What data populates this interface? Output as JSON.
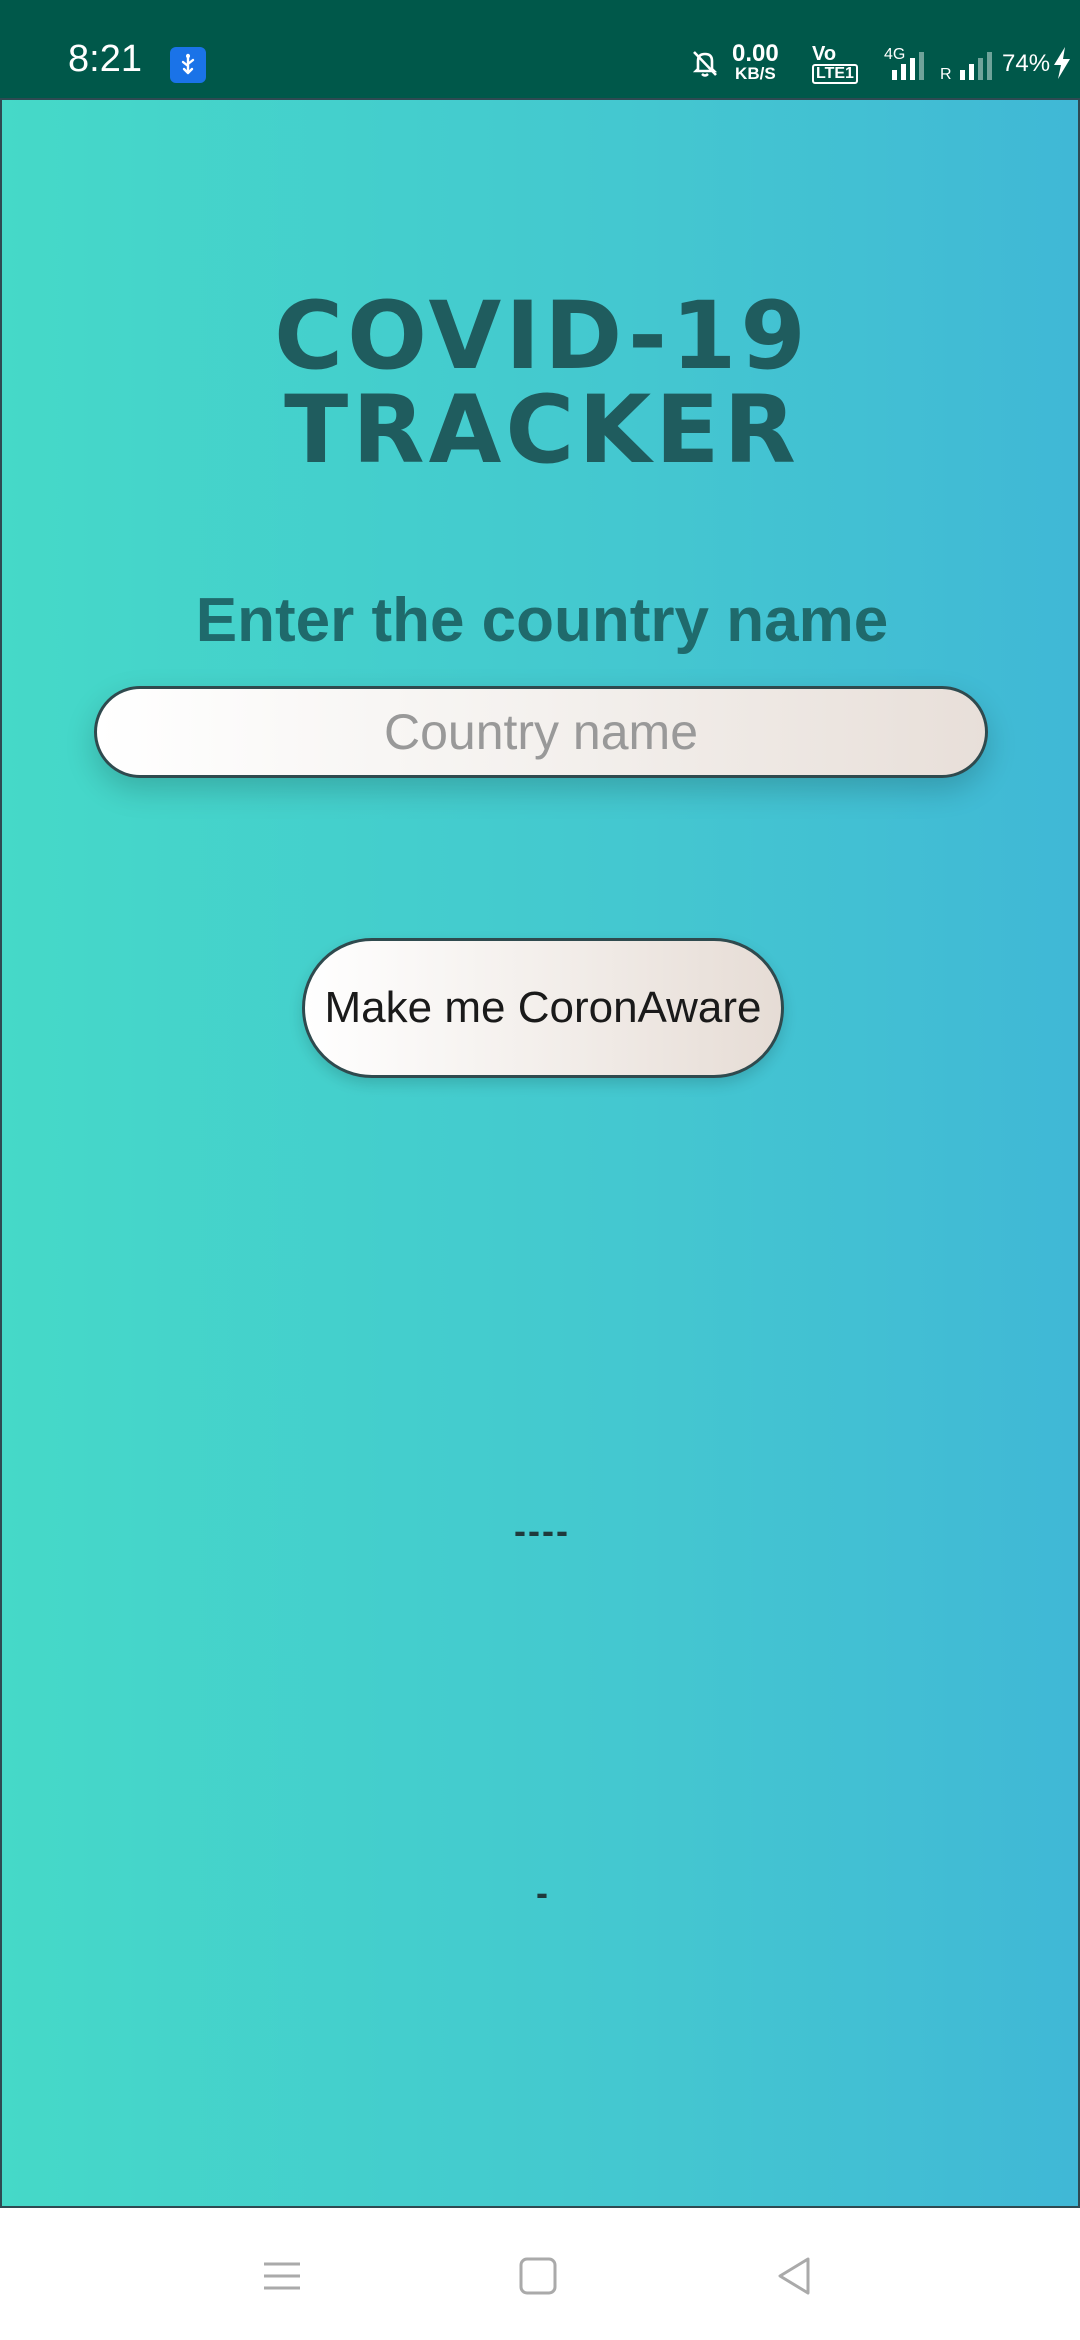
{
  "status_bar": {
    "time": "8:21",
    "net_speed_value": "0.00",
    "net_speed_unit": "KB/S",
    "volte_top": "Vo",
    "volte_bottom": "LTE1",
    "network_type": "4G",
    "roaming": "R",
    "battery": "74%",
    "icons": [
      "usb-icon",
      "bell-off-icon",
      "signal-icon",
      "charging-bolt-icon"
    ]
  },
  "app": {
    "title": "COVID-19 TRACKER",
    "prompt": "Enter the country name",
    "input": {
      "value": "",
      "placeholder": "Country name"
    },
    "button_label": "Make me CoronAware",
    "result_line_1": "----",
    "result_line_2": "-"
  },
  "nav_bar": {
    "icons": [
      "menu-icon",
      "home-icon",
      "back-icon"
    ]
  },
  "colors": {
    "status_bar_bg": "#00584a",
    "gradient_start": "#45d9c8",
    "gradient_end": "#40b8d6",
    "title_color": "#1f5c5e"
  }
}
